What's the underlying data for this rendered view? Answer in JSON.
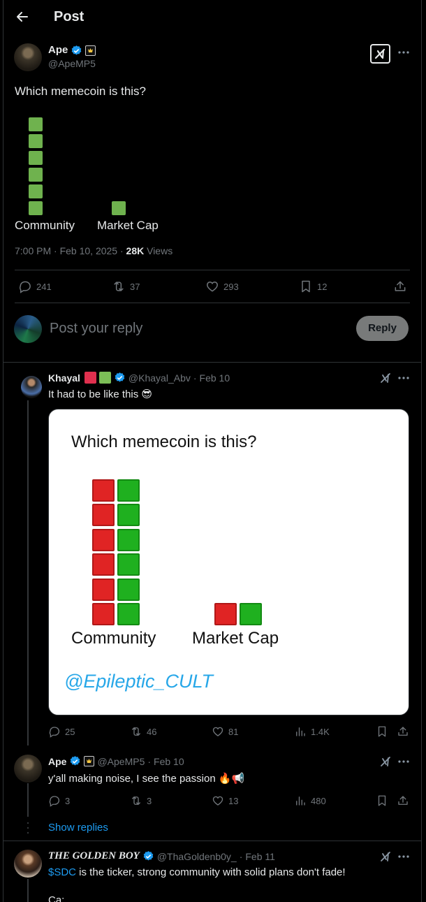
{
  "header": {
    "title": "Post"
  },
  "main_post": {
    "author_name": "Ape",
    "author_handle": "@ApeMP5",
    "text": "Which memecoin is this?",
    "chart_data": {
      "type": "bar",
      "categories": [
        "Community",
        "Market Cap"
      ],
      "values": [
        6,
        1
      ]
    },
    "timestamp": "7:00 PM · Feb 10, 2025 · ",
    "views_count": "28K",
    "views_label": " Views",
    "replies": "241",
    "reposts": "37",
    "likes": "293",
    "bookmarks": "12"
  },
  "reply_box": {
    "placeholder": "Post your reply",
    "button": "Reply"
  },
  "replies": [
    {
      "name": "Khayal",
      "handle": "@Khayal_Abv",
      "time": "Feb 10",
      "text": "It had to be like this 😎",
      "image": {
        "title": "Which memecoin is this?",
        "chart_data": {
          "type": "bar",
          "categories": [
            "Community",
            "Market Cap"
          ],
          "series": [
            {
              "values": [
                6,
                1
              ],
              "color": "#e02424"
            },
            {
              "values": [
                6,
                1
              ],
              "color": "#1fb01f"
            }
          ]
        },
        "watermark": "@Epileptic_CULT"
      },
      "stats": {
        "replies": "25",
        "reposts": "46",
        "likes": "81",
        "views": "1.4K"
      }
    },
    {
      "name": "Ape",
      "handle": "@ApeMP5",
      "time": "Feb 10",
      "text": "y'all making noise, I see the passion 🔥📢",
      "stats": {
        "replies": "3",
        "reposts": "3",
        "likes": "13",
        "views": "480"
      }
    },
    {
      "name": "THE GOLDEN BOY",
      "handle": "@ThaGoldenb0y_",
      "time": "Feb 11",
      "ticker": "$SDC",
      "text": " is the ticker, strong community with solid plans don't fade!",
      "text2": "Ca:"
    }
  ],
  "show_replies": "Show replies",
  "dot_sep": "·",
  "colors": {
    "background": "#000000",
    "accent": "#1d9bf0",
    "text": "#e7e9ea",
    "muted": "#71767b",
    "border": "#2f3336"
  }
}
